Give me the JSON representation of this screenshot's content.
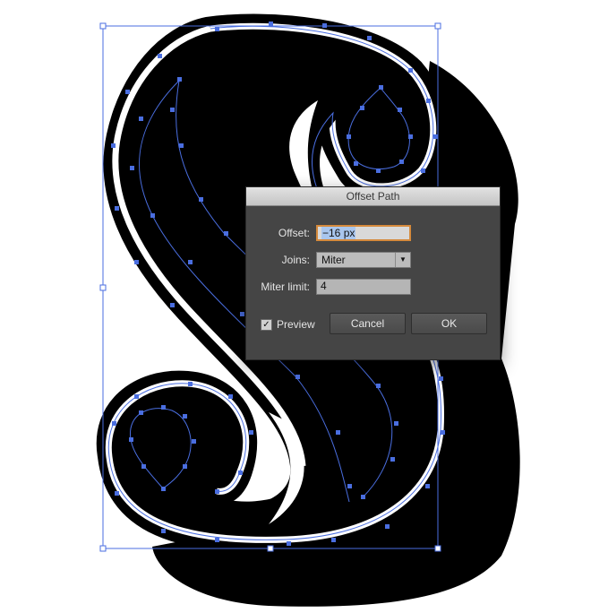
{
  "dialog": {
    "title": "Offset Path",
    "offset": {
      "label": "Offset:",
      "value": "−16 px"
    },
    "joins": {
      "label": "Joins:",
      "value": "Miter"
    },
    "miter_limit": {
      "label": "Miter limit:",
      "value": "4"
    },
    "preview": {
      "label": "Preview",
      "checked": true,
      "check_glyph": "✓"
    },
    "cancel_label": "Cancel",
    "ok_label": "OK"
  },
  "colors": {
    "selection": "#4a6ee0",
    "dialog_bg": "#454545",
    "focus_ring": "#d58a3c"
  },
  "icons": {
    "select_arrow": "▼"
  }
}
